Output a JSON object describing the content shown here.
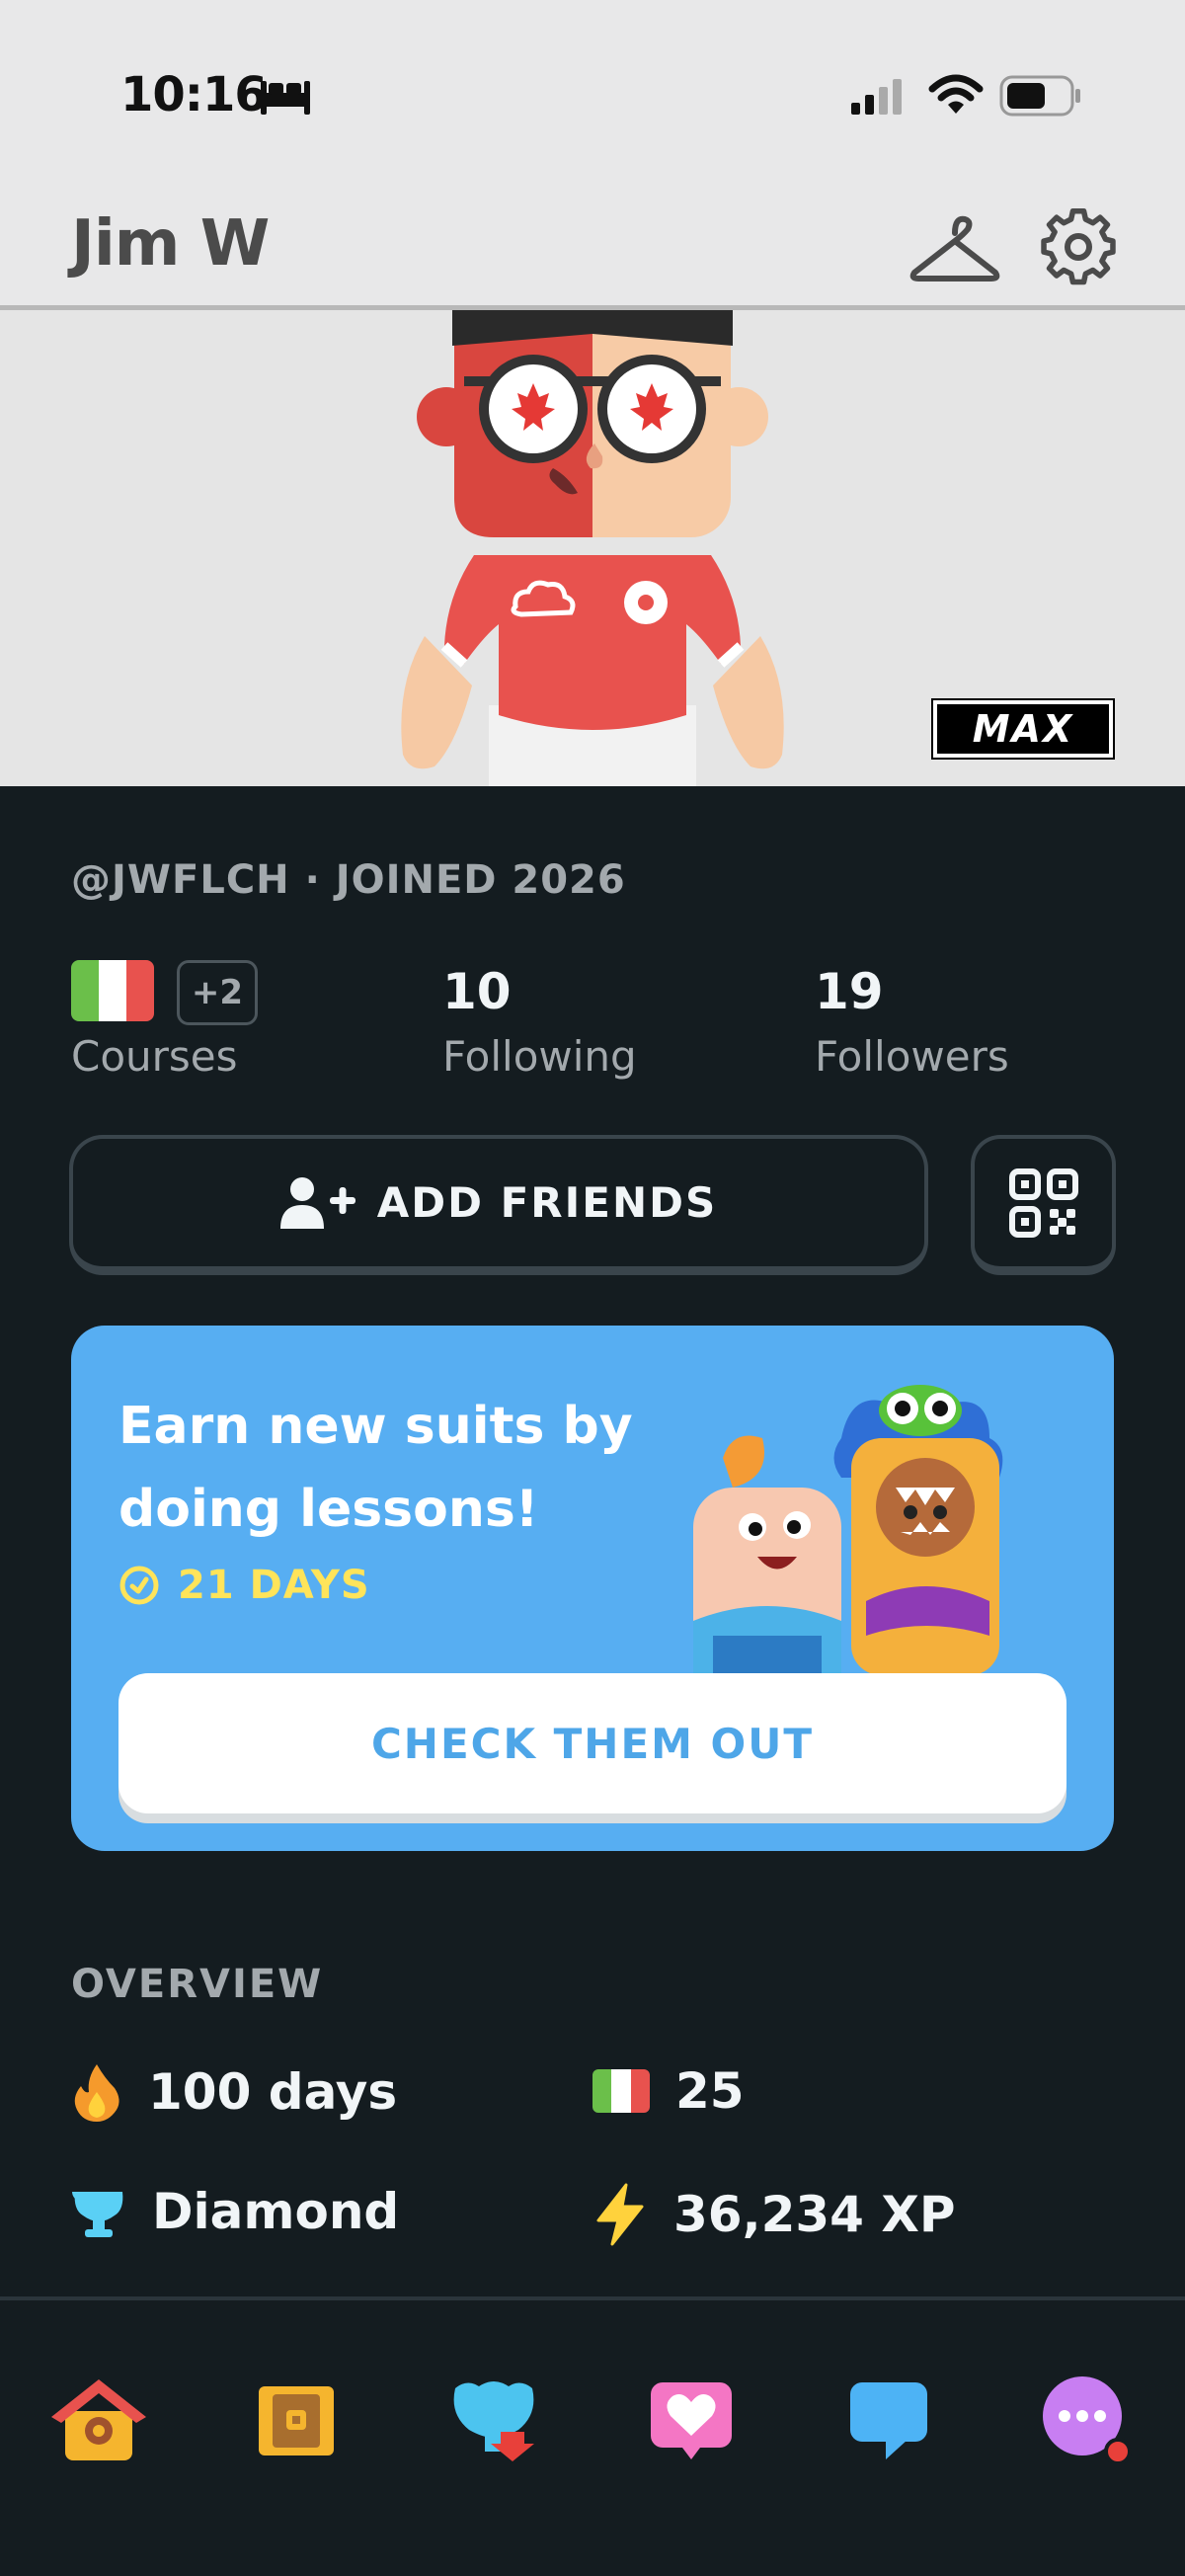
{
  "status_bar": {
    "time": "10:16"
  },
  "header": {
    "name": "Jim W"
  },
  "avatar": {
    "badge": "MAX"
  },
  "profile": {
    "handle": "@JWFLCH · JOINED 2026",
    "courses_extra": "+2",
    "courses_label": "Courses",
    "following_count": "10",
    "following_label": "Following",
    "followers_count": "19",
    "followers_label": "Followers"
  },
  "actions": {
    "add_friends": "ADD FRIENDS"
  },
  "promo": {
    "title": "Earn new suits by doing lessons!",
    "days": "21 DAYS",
    "button": "CHECK THEM OUT"
  },
  "overview": {
    "title": "OVERVIEW",
    "streak": "100 days",
    "course_score": "25",
    "league": "Diamond",
    "xp": "36,234 XP"
  },
  "colors": {
    "background": "#141c20",
    "promo_blue": "#57aef2",
    "accent_yellow": "#ffe45a"
  },
  "nav": [
    "home-icon",
    "chest-icon",
    "league-icon",
    "heart-icon",
    "chat-icon",
    "more-icon"
  ]
}
